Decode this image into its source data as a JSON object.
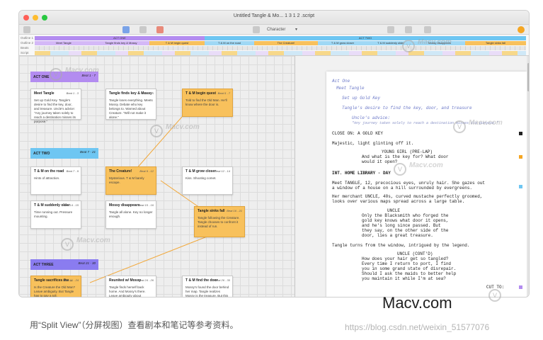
{
  "window": {
    "title": "Untitled Tangle & Mo... 1 3 1 2 .script",
    "toolbar": {
      "character_label": "Character",
      "dropdown_icon": "chevron-down-icon"
    }
  },
  "tracks": {
    "labels": [
      "Outline 1",
      "Outline 2",
      "Beats",
      "Script"
    ],
    "acts": [
      "ACT ONE",
      "ACT TWO"
    ],
    "sequences": [
      "Meet Tangle",
      "Tangle finds key & Mossy",
      "T & M begin quest",
      "T & M on the road",
      "The Creature!",
      "T & M grow closer",
      "T & M suddenly older",
      "Mossy disappears",
      "Tangle sinks fall"
    ]
  },
  "board": {
    "acts": [
      {
        "label": "ACT ONE",
        "beat": "Beat 1 - 7",
        "color": "#b38cf0"
      },
      {
        "label": "ACT TWO",
        "beat": "Beat 7 - 21",
        "color": "#6ec6f2"
      },
      {
        "label": "ACT THREE",
        "beat": "Beat 21 - 30",
        "color": "#8a7cf0"
      }
    ],
    "cards": [
      {
        "title": "Meet Tangle",
        "beat": "Beat 1 - 3",
        "body": "Set up Gold Key. Tangle's desire to find the key, door, and treasure. Uncle's advice: \"Any journey taken solely to reach a destination misses its purpose.\"",
        "orange": false
      },
      {
        "title": "Tangle finds key & Mossy",
        "beat": "Beat 3 - 5",
        "body": "Tangle loses everything. Meets Mossy. Debate who key belongs to. Warned about Creature. \"Will not make it alone.\"",
        "orange": false
      },
      {
        "title": "T & M begin quest",
        "beat": "Beat 5 - 7",
        "body": "Told to find the Old Man. He'll know where the door is.",
        "orange": true
      },
      {
        "title": "T & M on the road",
        "beat": "Beat 7 - 9",
        "body": "Hints of attraction.",
        "orange": false
      },
      {
        "title": "The Creature!",
        "beat": "Beat 9 - 12",
        "body": "Mysterious. T & M barely escape.",
        "orange": true
      },
      {
        "title": "T & M grow closer",
        "beat": "Beat 12 - 14",
        "body": "Kiss. Shooting comet.",
        "orange": false
      },
      {
        "title": "T & M suddenly older",
        "beat": "Beat 14 - 15",
        "body": "Time running out. Pressure mounting.",
        "orange": false
      },
      {
        "title": "Mossy disappears",
        "beat": "Beat 15 - 16",
        "body": "Tangle all alone. Key no longer enough.",
        "orange": false
      },
      {
        "title": "Tangle sinks fall",
        "beat": "Beat 16 - 21",
        "body": "Tangle following the Creature. Tangle chooses to confront it instead of run.",
        "orange": true
      },
      {
        "title": "Tangle sacrifices the ...",
        "beat": "Beat 21 - 24",
        "body": "Is the Creature the Old Man? Leave ambiguity. But Tangle has to pay a toll.",
        "orange": true
      },
      {
        "title": "Reunited w/ Mossy",
        "beat": "Beat 24 - 26",
        "body": "Tangle finds herself back home. And Mossy's there. Leave ambiguity about whether this is real or imagined.",
        "orange": false
      },
      {
        "title": "T & M find the door",
        "beat": "Beat 26 - 30",
        "body": "Mossy's found the door behind her map. Tangle realizes Mossy is the treasure. But this will not be.",
        "orange": false
      }
    ]
  },
  "script": {
    "lines": [
      {
        "text": "Act One",
        "style": "note"
      },
      {
        "text": "Meet Tangle",
        "style": "note"
      },
      {
        "text": "Set up Gold Key",
        "style": "note"
      },
      {
        "text": "Tangle's desire to find the key, door, and treasure",
        "style": "note"
      },
      {
        "text": "Uncle's advice:",
        "style": "note"
      },
      {
        "text": "\"Any journey taken solely to reach a destination misses its purpose.\"",
        "style": "note-sm"
      },
      {
        "text": "CLOSE ON: A GOLD KEY",
        "style": "plain"
      },
      {
        "text": "Majestic, light glinting off it.",
        "style": "plain"
      },
      {
        "text": "YOUNG GIRL (PRE-LAP)",
        "style": "plain"
      },
      {
        "text": "And what is the key for? What door",
        "style": "plain"
      },
      {
        "text": "would it open?",
        "style": "plain"
      },
      {
        "text": "INT. HOME LIBRARY - DAY",
        "style": "bold"
      },
      {
        "text": "Meet TANGLE, 12, precocious eyes, unruly hair. She gazes out",
        "style": "plain"
      },
      {
        "text": "a window of a house on a hill surrounded by evergreens.",
        "style": "plain"
      },
      {
        "text": "Her merchant UNCLE, 40s, curved mustache perfectly groomed,",
        "style": "plain"
      },
      {
        "text": "looks over various maps spread across a large table.",
        "style": "plain"
      },
      {
        "text": "UNCLE",
        "style": "plain"
      },
      {
        "text": "Only the Blacksmith who forged the",
        "style": "plain"
      },
      {
        "text": "gold key knows what door it opens,",
        "style": "plain"
      },
      {
        "text": "and he's long since passed. But",
        "style": "plain"
      },
      {
        "text": "they say, on the other side of the",
        "style": "plain"
      },
      {
        "text": "door, lies a great treasure.",
        "style": "plain"
      },
      {
        "text": "Tangle turns from the window, intrigued by the legend.",
        "style": "plain"
      },
      {
        "text": "UNCLE (CONT'D)",
        "style": "plain"
      },
      {
        "text": "How does your hair get so tangled?",
        "style": "plain"
      },
      {
        "text": "Every time I return to port, I find",
        "style": "plain"
      },
      {
        "text": "you in some grand state of disrepair.",
        "style": "plain"
      },
      {
        "text": "Should I ask the maids to better help",
        "style": "plain"
      },
      {
        "text": "you maintain it while I'm at sea?",
        "style": "plain"
      },
      {
        "text": "CUT TO:",
        "style": "plain"
      }
    ]
  },
  "watermarks": {
    "brand": "Macv.com",
    "caption": "用“Split View”（分屏视图）查看剧本和笔记等参考资料。",
    "csdn": "https://blog.csdn.net/weixin_51577076"
  },
  "colors": {
    "card_orange": "#f8c15c",
    "act_one": "#b38cf0",
    "act_two": "#6ec6f2",
    "act_three": "#8a7cf0",
    "script_note": "#6b78c8"
  }
}
